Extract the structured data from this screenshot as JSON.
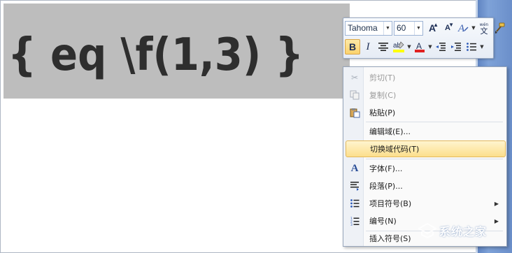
{
  "document": {
    "field_code_text": "{ eq \\f(1,3) }"
  },
  "mini_toolbar": {
    "font_name": "Tahoma",
    "font_size": "60",
    "grow_font_label": "A",
    "shrink_font_label": "A",
    "bold_label": "B",
    "italic_label": "I",
    "highlight_label": "ab",
    "font_color_label": "A",
    "phonetic_label": "wén",
    "phonetic_char": "文",
    "colors": {
      "highlight": "#ffff00",
      "font_color": "#e02020",
      "bold_active": "#fbd26d"
    }
  },
  "context_menu": {
    "items": [
      {
        "label": "剪切(T)",
        "icon": "scissors-icon",
        "disabled": true
      },
      {
        "label": "复制(C)",
        "icon": "copy-icon",
        "disabled": true
      },
      {
        "label": "粘贴(P)",
        "icon": "paste-icon",
        "disabled": false
      },
      {
        "label": "编辑域(E)...",
        "icon": "",
        "disabled": false
      },
      {
        "label": "切换域代码(T)",
        "icon": "",
        "disabled": false,
        "highlighted": true
      },
      {
        "label": "字体(F)...",
        "icon": "font-icon",
        "disabled": false
      },
      {
        "label": "段落(P)...",
        "icon": "paragraph-icon",
        "disabled": false
      },
      {
        "label": "项目符号(B)",
        "icon": "bullets-icon",
        "disabled": false,
        "submenu": true
      },
      {
        "label": "编号(N)",
        "icon": "numbering-icon",
        "disabled": false,
        "submenu": true
      },
      {
        "label": "插入符号(S)",
        "icon": "",
        "disabled": false
      }
    ]
  },
  "watermark": {
    "text": "系统之家"
  }
}
